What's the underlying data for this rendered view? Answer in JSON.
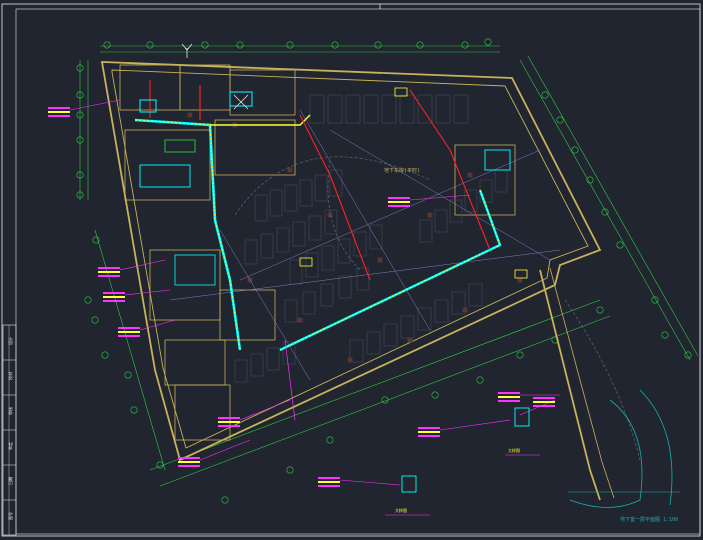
{
  "drawing": {
    "center_label": "地下车库(平时)",
    "legend_main": "地下室一层平面图 1:100",
    "detail_label_1": "大样图",
    "detail_label_2": "大样图",
    "title_block_fields": [
      "设计",
      "校对",
      "审核",
      "审定",
      "日期",
      "图号"
    ]
  },
  "colors": {
    "background": "#202530",
    "wall": "#c8b25a",
    "dim": "#2ecc40",
    "annotation": "#ff33ff",
    "pipe_cyan": "#00ffff",
    "pipe_yellow": "#ffff33",
    "pipe_red": "#ff2222",
    "grid_purple": "#8878c8",
    "white": "#e8e8e8"
  },
  "icons": [
    "north-arrow-icon",
    "column-icon",
    "grid-bubble-icon",
    "stair-icon"
  ]
}
